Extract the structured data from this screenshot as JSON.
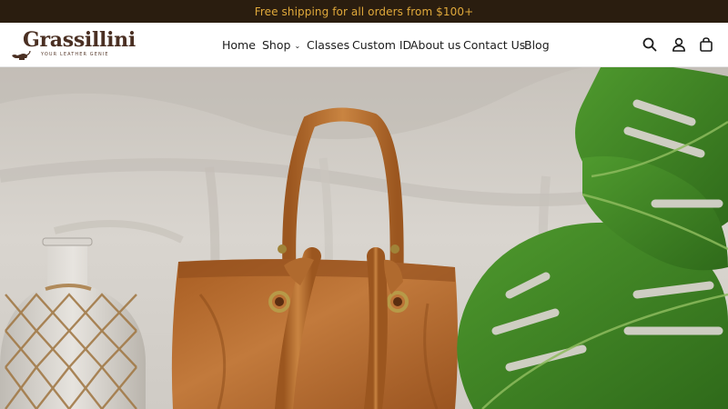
{
  "announcement": {
    "text": "Free shipping for all orders from $100+"
  },
  "brand": {
    "name": "Grassillini",
    "tagline": "YOUR LEATHER GENIE"
  },
  "nav": {
    "items": [
      {
        "label": "Home"
      },
      {
        "label": "Shop"
      },
      {
        "label": "Classes"
      },
      {
        "label": "Custom ID"
      },
      {
        "label": "About us"
      },
      {
        "label": "Contact Us"
      },
      {
        "label": "Blog"
      }
    ]
  },
  "header_icons": [
    "search-icon",
    "account-icon",
    "cart-icon"
  ],
  "colors": {
    "announcement_bg": "#2a1d0f",
    "announcement_text": "#e0a93b",
    "brand": "#4a2f22",
    "leather": "#b06a2e"
  },
  "hero": {
    "image": "hero-leather-tote-photo"
  }
}
